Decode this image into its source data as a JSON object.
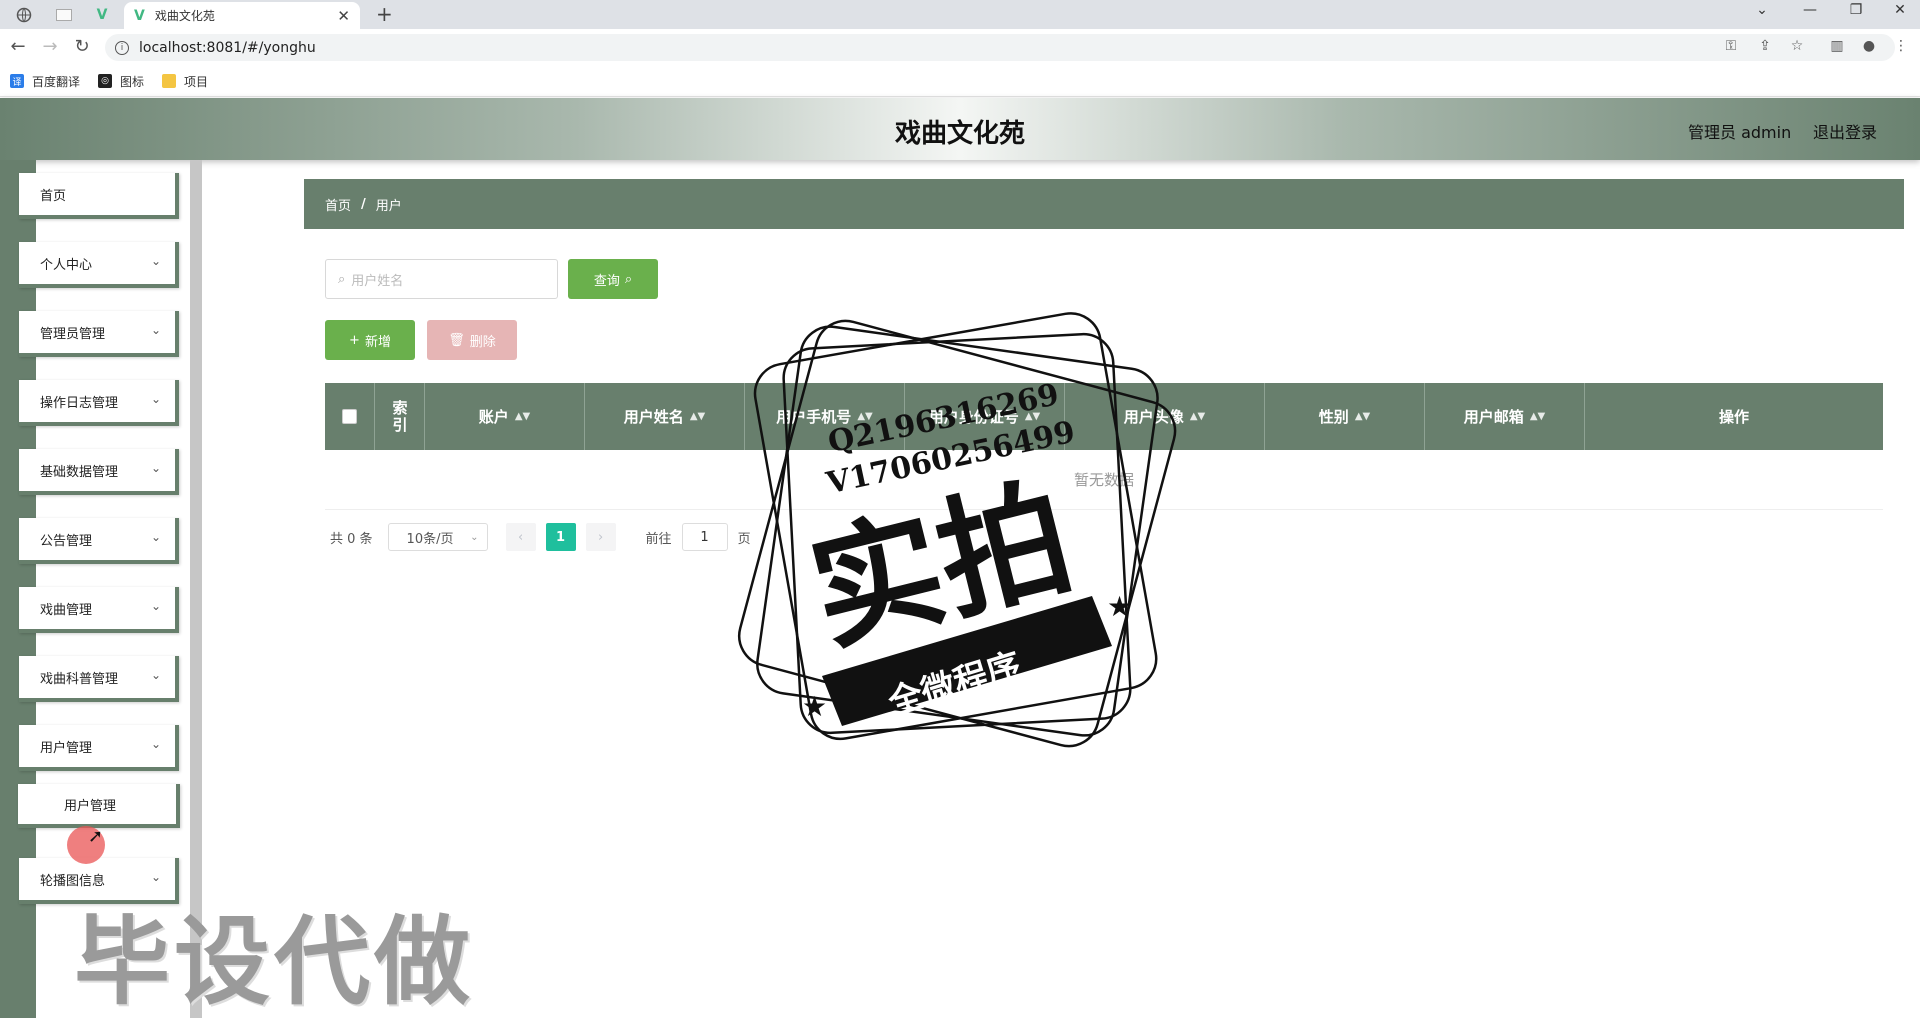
{
  "browser": {
    "tab_title": "戏曲文化苑",
    "url": "localhost:8081/#/yonghu",
    "bookmarks": [
      {
        "label": "百度翻译",
        "icon": "translate-icon",
        "color": "#2b7de9"
      },
      {
        "label": "图标",
        "icon": "iconfont-icon",
        "color": "#222222"
      },
      {
        "label": "项目",
        "icon": "folder-icon",
        "color": "#f4c542"
      }
    ]
  },
  "header": {
    "title": "戏曲文化苑",
    "user_role": "管理员 admin",
    "logout": "退出登录"
  },
  "sidebar": {
    "items": [
      {
        "label": "首页",
        "has_children": false
      },
      {
        "label": "个人中心",
        "has_children": true
      },
      {
        "label": "管理员管理",
        "has_children": true
      },
      {
        "label": "操作日志管理",
        "has_children": true
      },
      {
        "label": "基础数据管理",
        "has_children": true
      },
      {
        "label": "公告管理",
        "has_children": true
      },
      {
        "label": "戏曲管理",
        "has_children": true
      },
      {
        "label": "戏曲科普管理",
        "has_children": true
      },
      {
        "label": "用户管理",
        "has_children": true
      },
      {
        "label": "用户管理",
        "is_sub": true
      },
      {
        "label": "轮播图信息",
        "has_children": true
      }
    ]
  },
  "breadcrumb": {
    "home": "首页",
    "separator": "/",
    "current": "用户"
  },
  "search": {
    "placeholder": "用户姓名",
    "query_button": "查询"
  },
  "actions": {
    "add": "新增",
    "delete": "删除"
  },
  "table": {
    "columns": [
      "索引",
      "账户",
      "用户姓名",
      "用户手机号",
      "用户身份证号",
      "用户头像",
      "性别",
      "用户邮箱",
      "操作"
    ],
    "empty_text": "暂无数据"
  },
  "pagination": {
    "total": "共 0 条",
    "page_size": "10条/页",
    "current_page": "1",
    "goto_label": "前往",
    "goto_value": "1",
    "page_suffix": "页"
  },
  "overlay": {
    "stamp_line1": "Q2196316269",
    "stamp_line2": "V17060256499",
    "stamp_big": "实拍",
    "stamp_ribbon": "全微程序",
    "bottom_watermark": "毕设代做"
  },
  "colors": {
    "theme": "#687f6d",
    "primary_button": "#6ab04c",
    "danger_button_disabled": "#e6b5b5",
    "active_page": "#1fbf9d"
  }
}
